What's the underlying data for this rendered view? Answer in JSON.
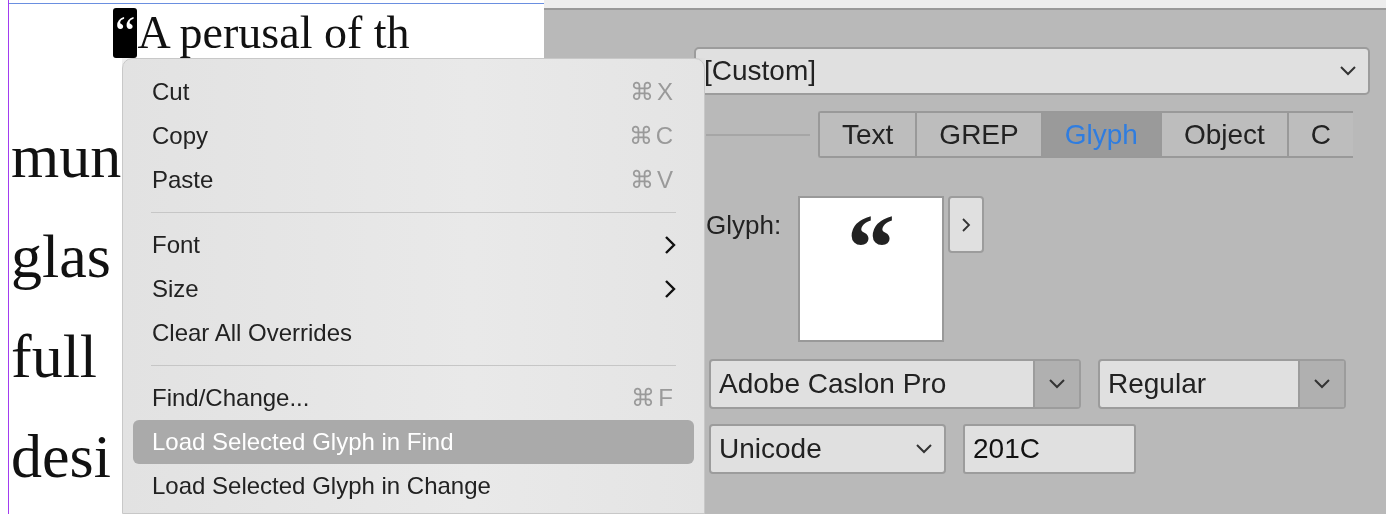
{
  "document": {
    "first_line": {
      "quote": "“",
      "quote_selected": true,
      "text": "A perusal of th"
    },
    "lines": [
      "mun",
      "glas",
      "full",
      "desi"
    ]
  },
  "context_menu": {
    "items": [
      {
        "kind": "item",
        "label": "Cut",
        "shortcut": "⌘X",
        "submenu": false,
        "selected": false
      },
      {
        "kind": "item",
        "label": "Copy",
        "shortcut": "⌘C",
        "submenu": false,
        "selected": false
      },
      {
        "kind": "item",
        "label": "Paste",
        "shortcut": "⌘V",
        "submenu": false,
        "selected": false
      },
      {
        "kind": "separator"
      },
      {
        "kind": "item",
        "label": "Font",
        "submenu": true,
        "selected": false
      },
      {
        "kind": "item",
        "label": "Size",
        "submenu": true,
        "selected": false
      },
      {
        "kind": "item",
        "label": "Clear All Overrides",
        "submenu": false,
        "selected": false
      },
      {
        "kind": "separator"
      },
      {
        "kind": "item",
        "label": "Find/Change...",
        "shortcut": "⌘F",
        "submenu": false,
        "selected": false
      },
      {
        "kind": "item",
        "label": "Load Selected Glyph in Find",
        "submenu": false,
        "selected": true
      },
      {
        "kind": "item",
        "label": "Load Selected Glyph in Change",
        "submenu": false,
        "selected": false
      }
    ]
  },
  "panel": {
    "query_dropdown": "[Custom]",
    "tabs": [
      {
        "label": "Text",
        "selected": false
      },
      {
        "label": "GREP",
        "selected": false
      },
      {
        "label": "Glyph",
        "selected": true
      },
      {
        "label": "Object",
        "selected": false
      },
      {
        "label": "C",
        "selected": false
      }
    ],
    "glyph_label": "Glyph:",
    "glyph_preview": "“",
    "font_family": "Adobe Caslon Pro",
    "font_style": "Regular",
    "id_type": "Unicode",
    "glyph_id": "201C"
  }
}
